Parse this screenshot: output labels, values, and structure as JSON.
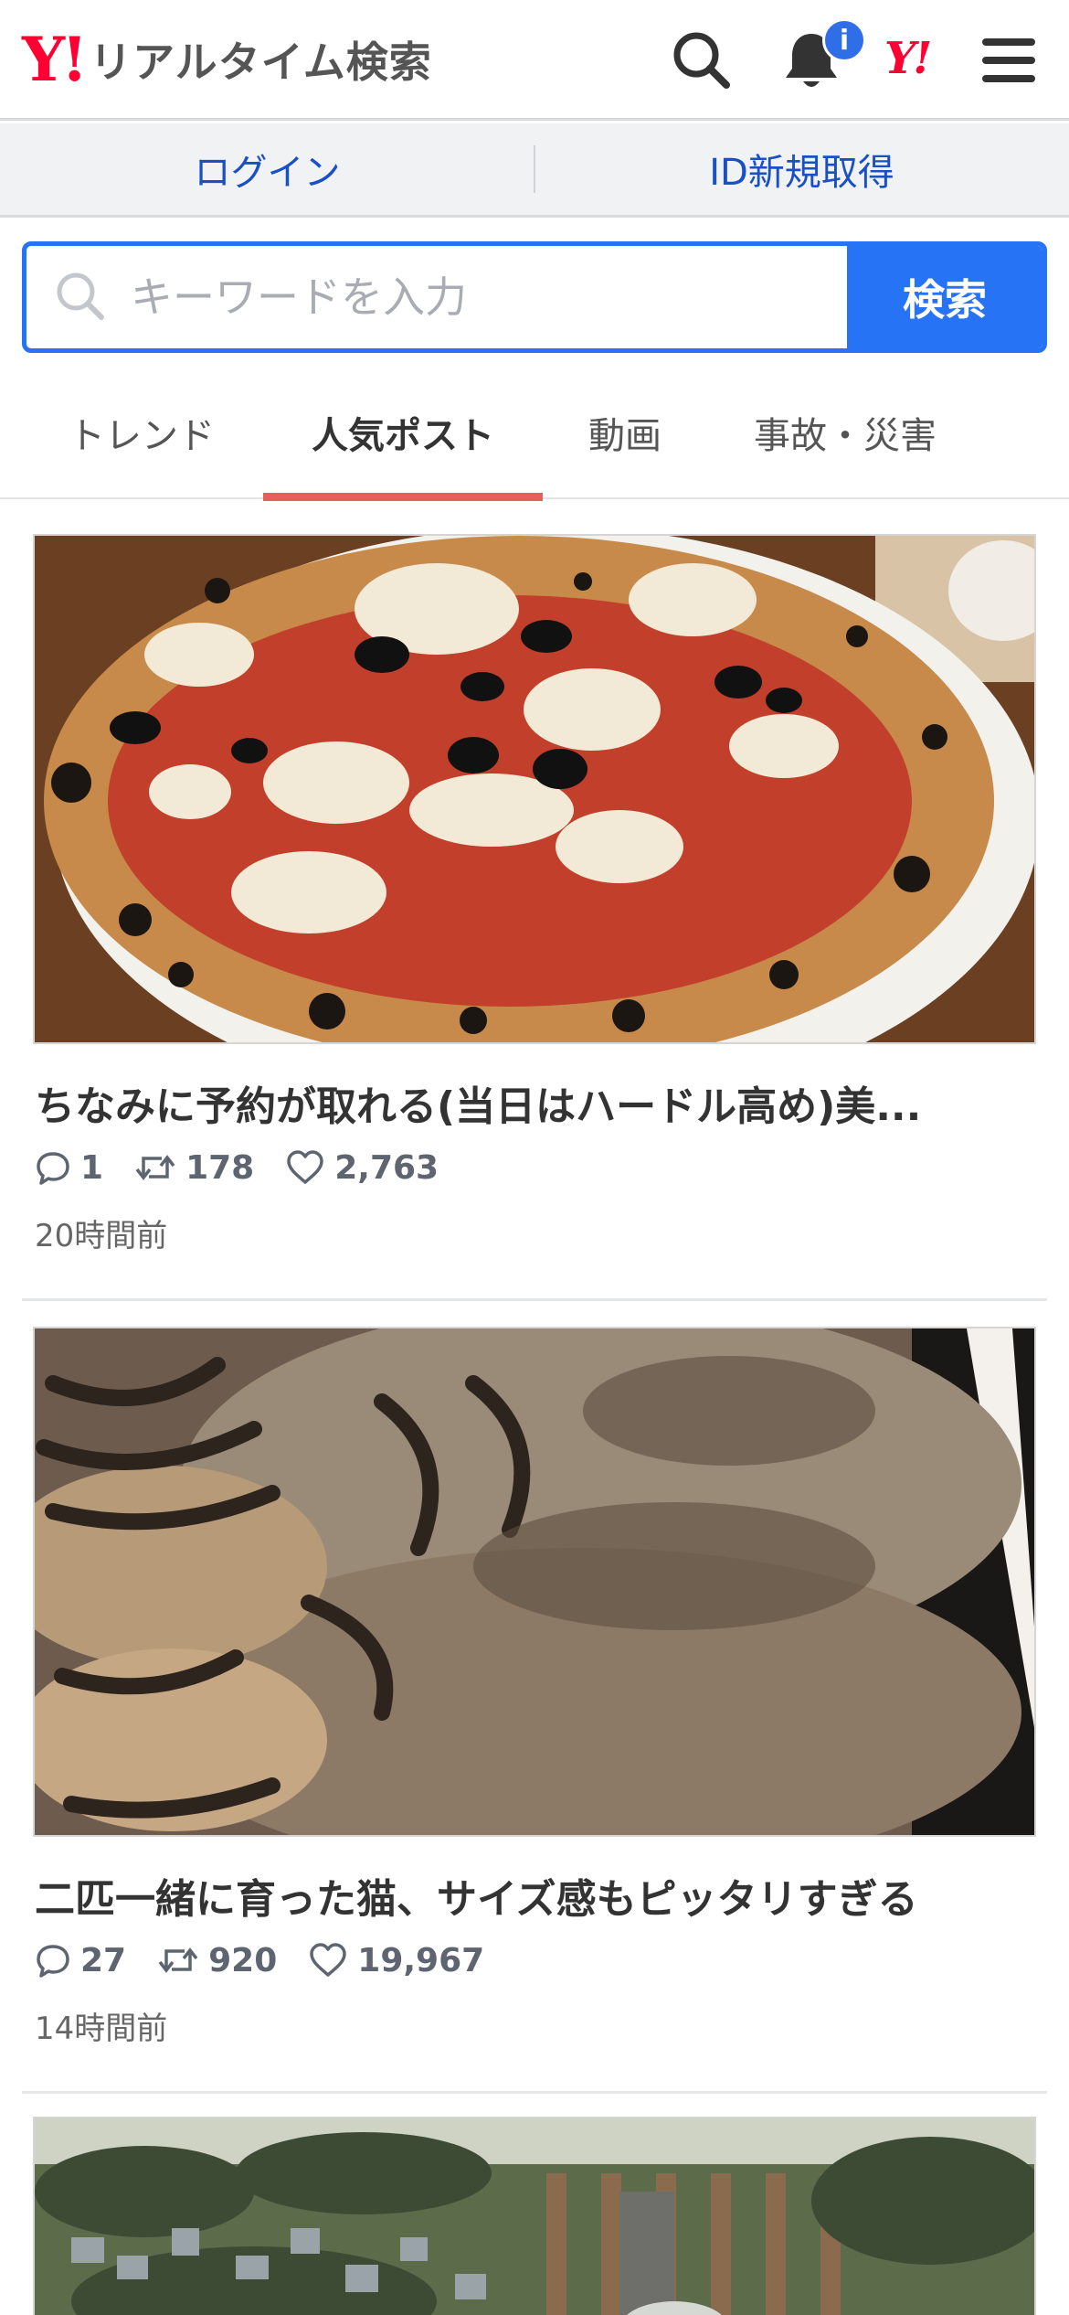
{
  "header": {
    "logo_y": "Y!",
    "logo_text": "リアルタイム検索",
    "notification_badge": "i",
    "ymark": "Y!"
  },
  "loginbar": {
    "login": "ログイン",
    "signup": "ID新規取得"
  },
  "search": {
    "placeholder": "キーワードを入力",
    "button": "検索"
  },
  "tabs": [
    "トレンド",
    "人気ポスト",
    "動画",
    "事故・災害"
  ],
  "active_tab": "人気ポスト",
  "posts": [
    {
      "image": "pizza-photo",
      "title": "ちなみに予約が取れる(当日はハードル高め)美...",
      "replies": "1",
      "reposts": "178",
      "likes": "2,763",
      "time": "20時間前"
    },
    {
      "image": "kittens-photo",
      "title": "二匹一緒に育った猫、サイズ感もピッタリすぎる",
      "replies": "27",
      "reposts": "920",
      "likes": "19,967",
      "time": "14時間前"
    },
    {
      "image": "garden-photo"
    }
  ],
  "colors": {
    "brand_red": "#ff0033",
    "accent_blue": "#2673f5",
    "link_blue": "#1a50c6",
    "tab_underline": "#e55f5d",
    "badge_blue": "#2f6ee6"
  },
  "icons": [
    "search-icon",
    "bell-icon",
    "menu-icon",
    "reply-icon",
    "repost-icon",
    "like-icon"
  ]
}
